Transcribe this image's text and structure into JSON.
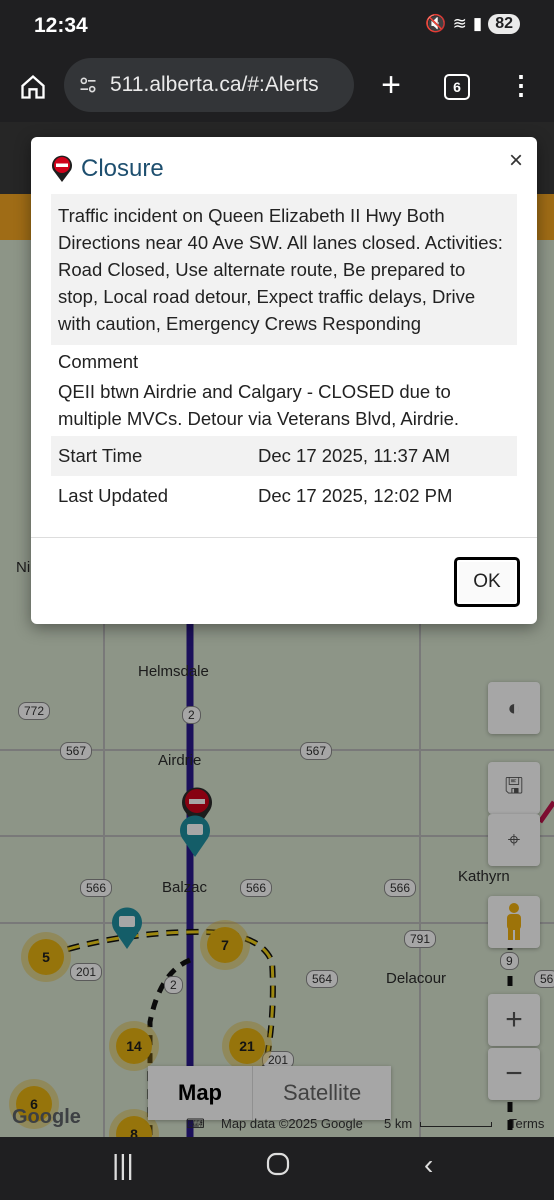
{
  "status": {
    "time": "12:34",
    "battery": "82"
  },
  "browser": {
    "url": "511.alberta.ca/#:Alerts",
    "tab_count": "6"
  },
  "map": {
    "towns": [
      "Helmsdale",
      "Airdrie",
      "Balzac",
      "Kathyrn",
      "Delacour",
      "Ni"
    ],
    "highways": [
      "772",
      "567",
      "567",
      "2",
      "566",
      "566",
      "566",
      "201",
      "2",
      "564",
      "791",
      "9",
      "201",
      "56"
    ],
    "clusters": [
      "5",
      "7",
      "14",
      "21",
      "6",
      "8"
    ],
    "map_type": {
      "map": "Map",
      "satellite": "Satellite"
    },
    "attribution": {
      "logo": "Google",
      "data": "Map data ©2025 Google",
      "scale": "5 km",
      "terms": "Terms"
    }
  },
  "modal": {
    "title": "Closure",
    "close": "×",
    "description": "Traffic incident on Queen Elizabeth II Hwy Both Directions near 40 Ave SW. All lanes closed. Activities: Road Closed, Use alternate route, Be prepared to stop, Local road detour, Expect traffic delays, Drive with caution, Emergency Crews Responding",
    "comment_label": "Comment",
    "comment": "QEII btwn Airdrie and Calgary - CLOSED due to multiple MVCs. Detour via Veterans Blvd, Airdrie.",
    "rows": [
      {
        "label": "Start Time",
        "value": "Dec 17 2025, 11:37 AM"
      },
      {
        "label": "Last Updated",
        "value": "Dec 17 2025, 12:02 PM"
      }
    ],
    "ok": "OK"
  }
}
